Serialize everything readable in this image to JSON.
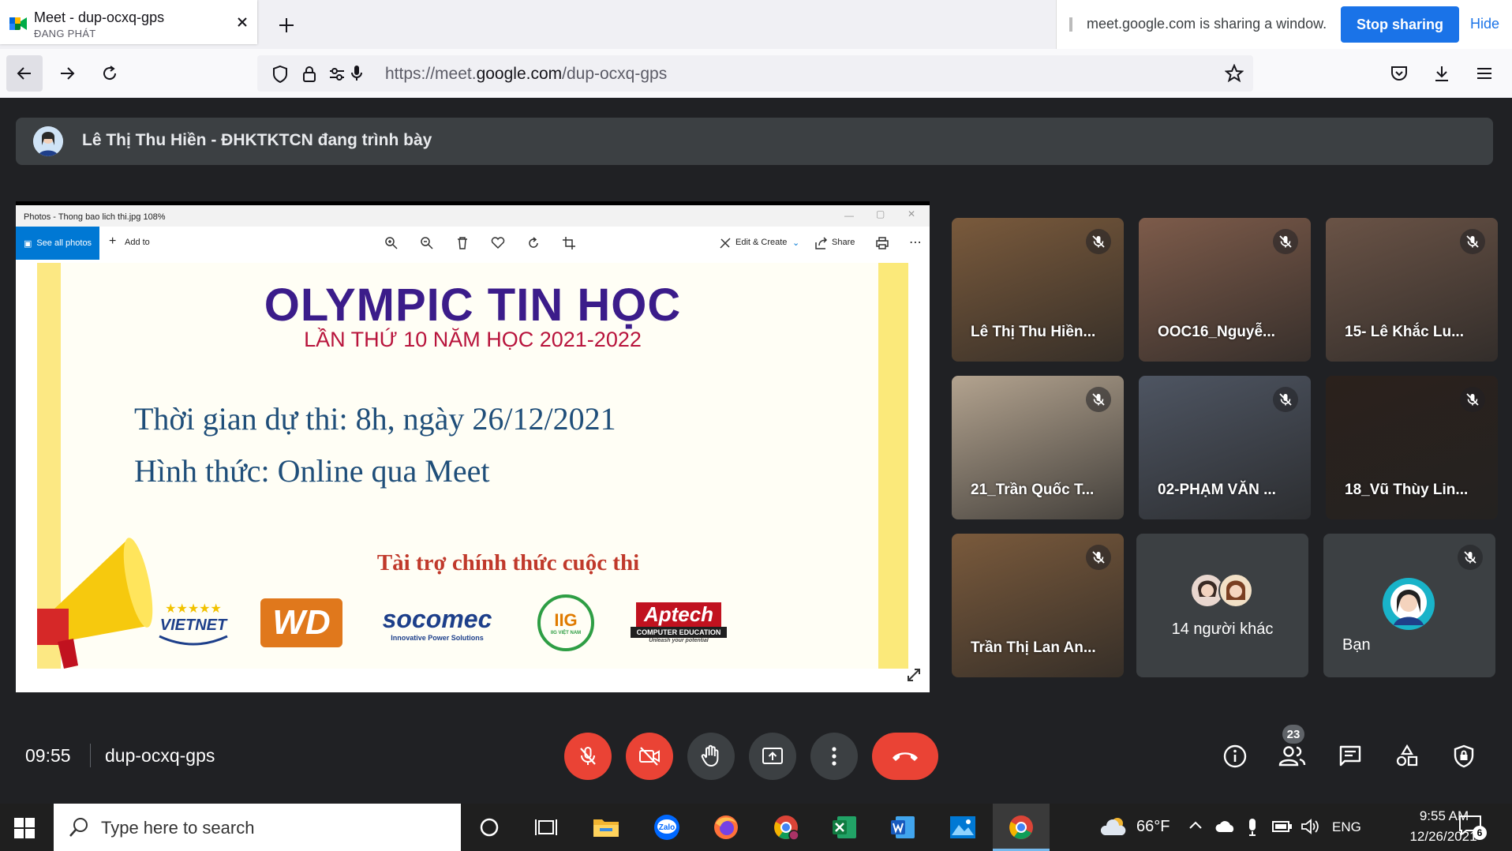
{
  "browser": {
    "tab_title": "Meet - dup-ocxq-gps",
    "tab_subtitle": "ĐANG PHÁT",
    "url_prefix": "https://meet.",
    "url_domain": "google.com",
    "url_path": "/dup-ocxq-gps",
    "sharing_message": "meet.google.com is sharing a window.",
    "stop_sharing_label": "Stop sharing",
    "hide_label": "Hide"
  },
  "meet": {
    "presenter_text": "Lê Thị Thu Hiền - ĐHKTKTCN đang trình bày",
    "time": "09:55",
    "meeting_code": "dup-ocxq-gps",
    "participant_count": "23",
    "others_label": "14 người khác",
    "self_label": "Bạn",
    "tiles": [
      {
        "name": "Lê Thị Thu Hiền...",
        "bg": "#7a5a3c"
      },
      {
        "name": "OOC16_Nguyễ...",
        "bg": "#7d5b4a"
      },
      {
        "name": "15- Lê Khắc Lu...",
        "bg": "#6a5346"
      },
      {
        "name": "21_Trần Quốc T...",
        "bg": "#b3a38f"
      },
      {
        "name": "02-PHẠM VĂN ...",
        "bg": "#4e5562"
      },
      {
        "name": "18_Vũ Thùy Lin...",
        "bg": "#2b211c"
      },
      {
        "name": "Trần Thị Lan An...",
        "bg": "#7a5a3c"
      }
    ]
  },
  "photos_app": {
    "window_title": "Photos - Thong bao lich thi.jpg   108%",
    "see_all": "See all photos",
    "add_to": "Add to",
    "edit_create": "Edit & Create",
    "share": "Share"
  },
  "slide": {
    "title": "OLYMPIC TIN HỌC",
    "subtitle": "LẦN THỨ 10 NĂM HỌC 2021-2022",
    "line1": "Thời gian dự thi:  8h, ngày 26/12/2021",
    "line2": "Hình thức: Online qua Meet",
    "sponsor_title": "Tài trợ chính thức cuộc thi",
    "sponsors": [
      "VIETNET",
      "WD",
      "socomec",
      "IIG",
      "Aptech"
    ],
    "sponsor_socomec_tagline": "Innovative Power Solutions",
    "sponsor_iig_tagline": "IIG VIỆT NAM",
    "sponsor_aptech_tagline": "COMPUTER EDUCATION",
    "sponsor_aptech_slogan": "Unleash your potential"
  },
  "taskbar": {
    "search_placeholder": "Type here to search",
    "weather": "66°F",
    "language": "ENG",
    "time": "9:55 AM",
    "date": "12/26/2021",
    "notification_count": "6",
    "zalo_label": "Zalo"
  },
  "colors": {
    "meet_bg": "#202124",
    "meet_red": "#ea4335",
    "accent_blue": "#1a73e8"
  }
}
